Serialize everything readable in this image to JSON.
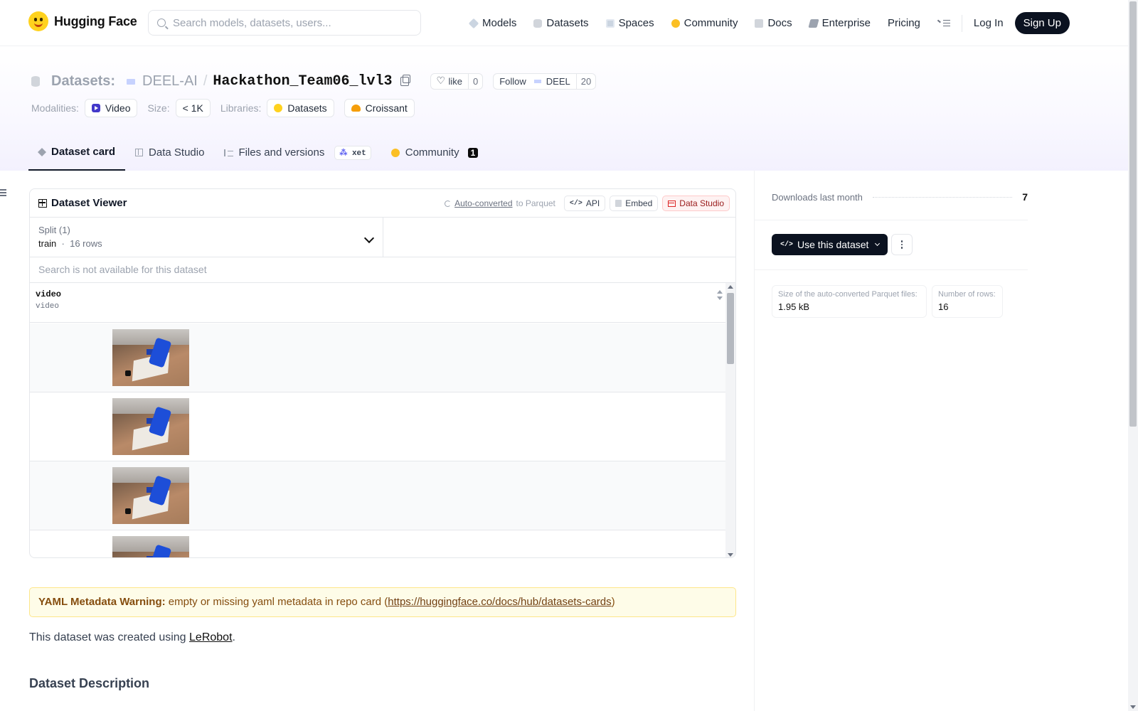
{
  "nav": {
    "brand": "Hugging Face",
    "search_placeholder": "Search models, datasets, users...",
    "links": [
      "Models",
      "Datasets",
      "Spaces",
      "Community",
      "Docs",
      "Enterprise",
      "Pricing"
    ],
    "login": "Log In",
    "signup": "Sign Up"
  },
  "header": {
    "crumb": "Datasets:",
    "org": "DEEL-AI",
    "repo": "Hackathon_Team06_lvl3",
    "like_label": "like",
    "like_count": "0",
    "follow_label": "Follow",
    "follow_org": "DEEL",
    "follow_count": "20",
    "modalities_label": "Modalities:",
    "modality": "Video",
    "size_label": "Size:",
    "size": "< 1K",
    "libraries_label": "Libraries:",
    "libraries": [
      "Datasets",
      "Croissant"
    ]
  },
  "tabs": {
    "dataset_card": "Dataset card",
    "data_studio": "Data Studio",
    "files": "Files and versions",
    "xet": "xet",
    "community": "Community",
    "community_count": "1"
  },
  "viewer": {
    "title": "Dataset Viewer",
    "auto_converted": "Auto-converted",
    "to_parquet": "to Parquet",
    "api": "API",
    "embed": "Embed",
    "data_studio": "Data Studio",
    "split_label": "Split (1)",
    "split_name": "train",
    "split_sep": "·",
    "split_rows": "16 rows",
    "search_na": "Search is not available for this dataset",
    "column_name": "video",
    "column_type": "video"
  },
  "card": {
    "warning_bold": "YAML Metadata Warning:",
    "warning_text": " empty or missing yaml metadata in repo card (",
    "warning_link": "https://huggingface.co/docs/hub/datasets-cards",
    "warning_end": ")",
    "created_prefix": "This dataset was created using ",
    "created_link": "LeRobot",
    "created_suffix": ".",
    "desc_heading": "Dataset Description"
  },
  "sidebar": {
    "downloads_label": "Downloads last month",
    "downloads_value": "7",
    "use_button": "Use this dataset",
    "parquet_label": "Size of the auto-converted Parquet files:",
    "parquet_value": "1.95 kB",
    "rows_label": "Number of rows:",
    "rows_value": "16"
  },
  "colors": {
    "accent_dark": "#0b1220",
    "warning_bg": "#fefce8",
    "warning_text": "#854d0e",
    "video_icon": "#4338ca"
  }
}
